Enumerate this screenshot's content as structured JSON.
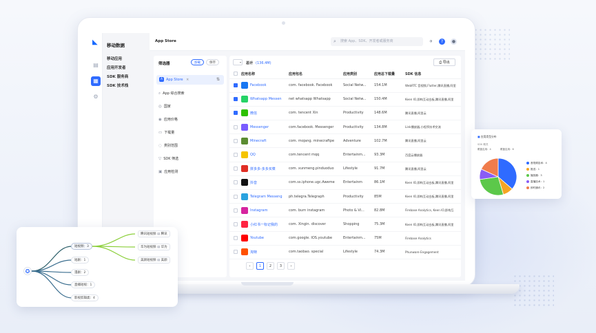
{
  "sidebar": {
    "title": "移动数据",
    "items": [
      {
        "label": "移动应用"
      },
      {
        "label": "应用开发者"
      },
      {
        "label": "SDK 服务商"
      },
      {
        "label": "SDK 技术栈"
      }
    ]
  },
  "header": {
    "title": "App Store",
    "search_placeholder": "搜索 App、SDK、开发者或服务商"
  },
  "filter": {
    "title": "筛选器",
    "load_label": "加载",
    "save_label": "保存",
    "store": "App Store",
    "items": [
      {
        "label": "App 综合搜索",
        "icon": "search-icon"
      },
      {
        "label": "国家",
        "icon": "globe-icon"
      },
      {
        "label": "应用价格",
        "icon": "price-icon"
      },
      {
        "label": "下载量",
        "icon": "download-icon"
      },
      {
        "label": "类别范围",
        "icon": "category-icon"
      },
      {
        "label": "SDK 筛选",
        "icon": "filter-icon"
      },
      {
        "label": "应用检测",
        "icon": "detect-icon"
      }
    ]
  },
  "table": {
    "total_label": "总计",
    "total_value": "(136.4M)",
    "export_label": "导出",
    "columns": [
      "应用名称",
      "应用包名",
      "应用类别",
      "应用总下载量",
      "SDK 信息"
    ],
    "rows": [
      {
        "checked": true,
        "name": "Facebook",
        "pkg": "com. facebook. Facebook",
        "cat": "Social Netw...",
        "dl": "154.1M",
        "sdk": "WebRTC 音视频,Flutter,腾讯直播,阿里",
        "color": "#1877f2"
      },
      {
        "checked": true,
        "name": "Whatsapp Messen",
        "pkg": "net whatsapp Whatsapp",
        "cat": "Social Netw...",
        "dl": "150.4M",
        "sdk": "Keen IO,即构互动白板,腾讯直播,阿里",
        "color": "#25d366"
      },
      {
        "checked": true,
        "name": "微信",
        "pkg": "com. tencent Xin",
        "cat": "Productivity",
        "dl": "148.6M",
        "sdk": "腾讯直播,阿里云",
        "color": "#2dc100"
      },
      {
        "checked": false,
        "name": "Messenger",
        "pkg": "com.facebook. Messenger",
        "cat": "Productivity",
        "dl": "134.8M",
        "sdk": "Link播放器,小程序技术交流",
        "color": "#7a5cff"
      },
      {
        "checked": false,
        "name": "Minecraft",
        "pkg": "com. mojang. minecraftpe",
        "cat": "Adventure",
        "dl": "102.7M",
        "sdk": "腾讯直播,阿里云",
        "color": "#5b8c32"
      },
      {
        "checked": false,
        "name": "QQ",
        "pkg": "com.tencent mqq",
        "cat": "Entertainm...",
        "dl": "93.3M",
        "sdk": "百度云播放器",
        "color": "#f5c400"
      },
      {
        "checked": false,
        "name": "拼多多-多多买菜",
        "pkg": "com. xunmeng.pinduoduo",
        "cat": "Lifestyle",
        "dl": "91.7M",
        "sdk": "腾讯直播,阿里云",
        "color": "#e02e24"
      },
      {
        "checked": false,
        "name": "抖音",
        "pkg": "com.ss.iphone.ugc.Aweme",
        "cat": "Entertainm",
        "dl": "86.1M",
        "sdk": "Keen IO,即构互动白板,腾讯直播,阿里",
        "color": "#111111"
      },
      {
        "checked": false,
        "name": "Telegram Messeng",
        "pkg": "ph.telegra.Telegraph",
        "cat": "Productivity",
        "dl": "85M",
        "sdk": "Keen IO,即构互动白板,腾讯直播,阿里",
        "color": "#2aa3df"
      },
      {
        "checked": false,
        "name": "Instagram",
        "pkg": "com. burn instagram",
        "cat": "Photo & Vi...",
        "dl": "82.8M",
        "sdk": "Firebase Analytics, Keen IO,即构互",
        "color": "#d6249f"
      },
      {
        "checked": false,
        "name": "小红书一标记我的",
        "pkg": "com. Xingin. discover",
        "cat": "Shopping",
        "dl": "75.3M",
        "sdk": "Keen IO,即构互动白板,腾讯直播,阿里",
        "color": "#ff2442"
      },
      {
        "checked": false,
        "name": "Youtube",
        "pkg": "com.google. IOS.youtube",
        "cat": "Entertainm...",
        "dl": "75M",
        "sdk": "Firebase Analytics",
        "color": "#ff0000"
      },
      {
        "checked": false,
        "name": "淘特",
        "pkg": "com.taobao. special",
        "cat": "Lifestyle",
        "dl": "74.3M",
        "sdk": "Phunware Engagement",
        "color": "#ff5000"
      }
    ],
    "pages": [
      "1",
      "2",
      "3"
    ],
    "prev": "‹",
    "next": "›"
  },
  "mindmap": {
    "center": "短视频：3",
    "branches": [
      "短剧：1",
      "漫剧：2",
      "直播短视：1",
      "影视剪辑类：4"
    ],
    "leaves": [
      {
        "label": "腾讯短视频",
        "tag": "腾讯"
      },
      {
        "label": "华为短视频",
        "tag": "华为"
      },
      {
        "label": "美颜短视频",
        "tag": "美颜"
      }
    ]
  },
  "pie_card": {
    "title": "应用类型分布",
    "subtitle": "SDK 概况",
    "meta_a": "覆盖应用：4",
    "meta_b": "覆盖应用：6",
    "legend": [
      {
        "label": "音视频技术：4",
        "color": "#2f6bff"
      },
      {
        "label": "推送：1",
        "color": "#f5a524"
      },
      {
        "label": "播放器：3",
        "color": "#5cc84a"
      },
      {
        "label": "直播技术：1",
        "color": "#8a5cf6"
      },
      {
        "label": "即时通讯：2",
        "color": "#f07c4c"
      }
    ]
  },
  "chart_data": {
    "type": "pie",
    "slices": [
      {
        "label": "音视频技术",
        "value": 4
      },
      {
        "label": "推送",
        "value": 1
      },
      {
        "label": "播放器",
        "value": 3
      },
      {
        "label": "直播技术",
        "value": 1
      },
      {
        "label": "即时通讯",
        "value": 2
      }
    ]
  }
}
